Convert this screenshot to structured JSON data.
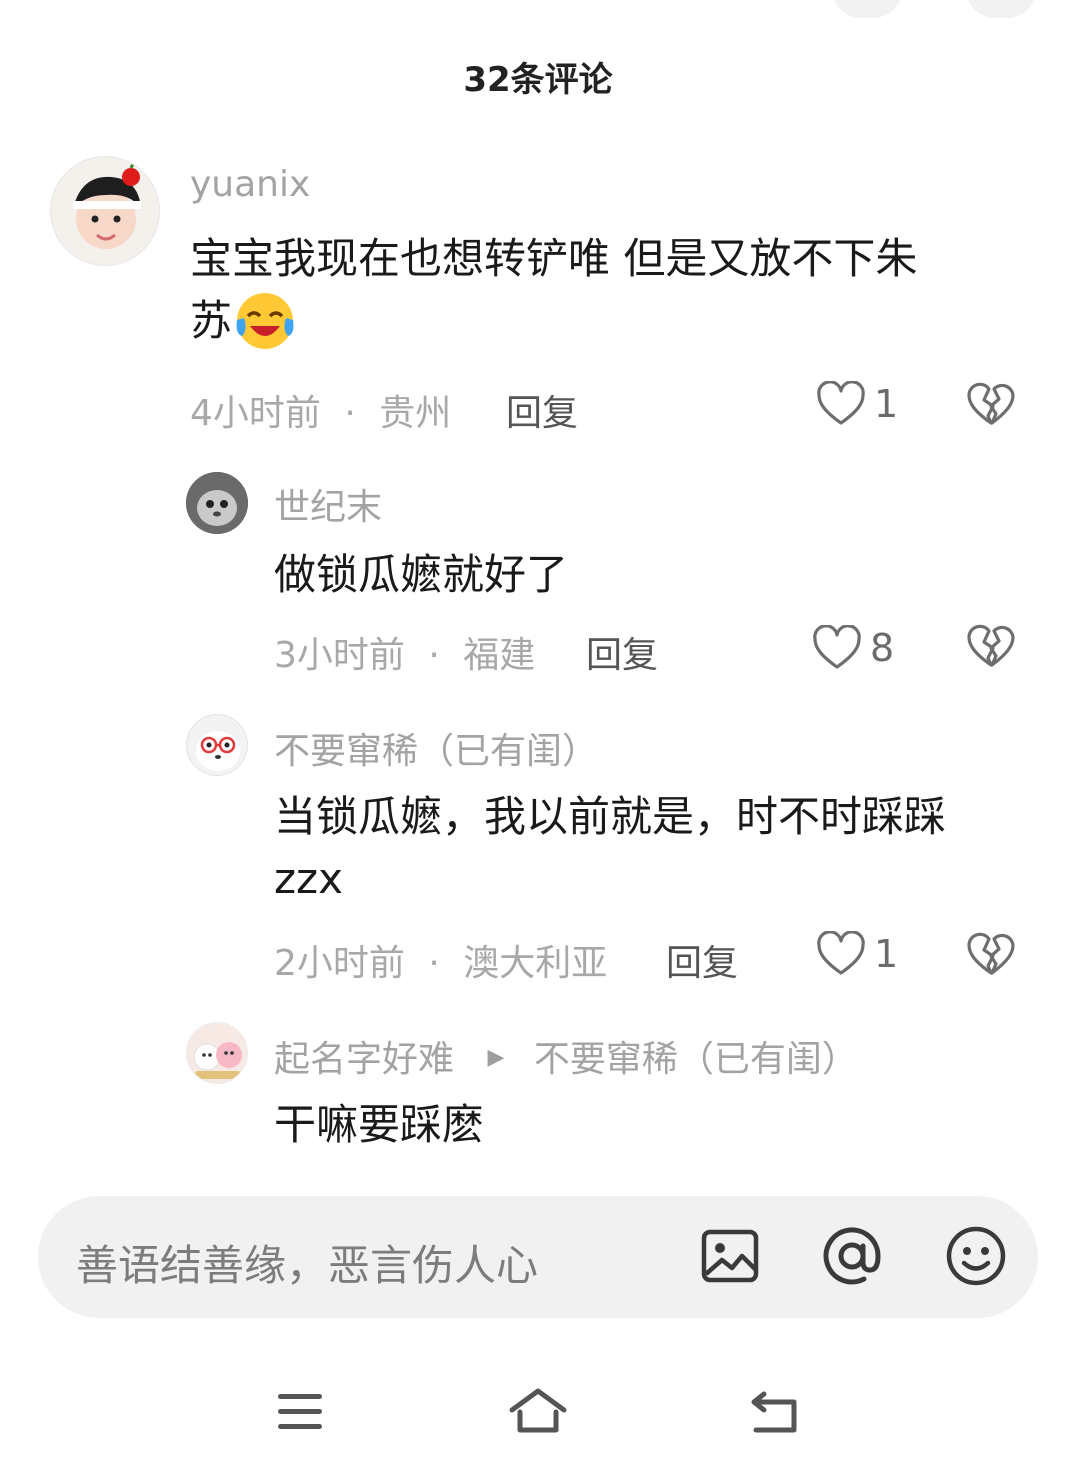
{
  "header": {
    "title": "32条评论"
  },
  "comments": [
    {
      "username": "yuanix",
      "text": "宝宝我现在也想转铲唯 但是又放不下朱苏",
      "text_line1": "宝宝我现在也想转铲唯 但是又放不下朱",
      "text_line2": "苏",
      "emoji": "crying-laughing-emoji",
      "time": "4小时前",
      "location": "贵州",
      "reply_label": "回复",
      "likes": "1"
    },
    {
      "username": "世纪末",
      "text": "做锁瓜嬷就好了",
      "time": "3小时前",
      "location": "福建",
      "reply_label": "回复",
      "likes": "8"
    },
    {
      "username": "不要窜稀（已有闺）",
      "text_line1": "当锁瓜嬷，我以前就是，时不时踩踩",
      "text_line2": "zzx",
      "time": "2小时前",
      "location": "澳大利亚",
      "reply_label": "回复",
      "likes": "1"
    },
    {
      "username": "起名字好难",
      "reply_to": "不要窜稀（已有闺）",
      "text": "干嘛要踩麽"
    }
  ],
  "separator": "·",
  "input": {
    "placeholder": "善语结善缘，恶言伤人心"
  },
  "icons": {
    "image": "image-icon",
    "mention": "at-icon",
    "emoji": "smiley-icon",
    "like": "heart-icon",
    "dislike": "broken-heart-icon",
    "nav_menu": "menu-icon",
    "nav_home": "home-icon",
    "nav_back": "back-icon"
  },
  "colors": {
    "meta_gray": "#a8a8a8",
    "text": "#1a1a1a",
    "input_bg": "#f1f1f1"
  }
}
